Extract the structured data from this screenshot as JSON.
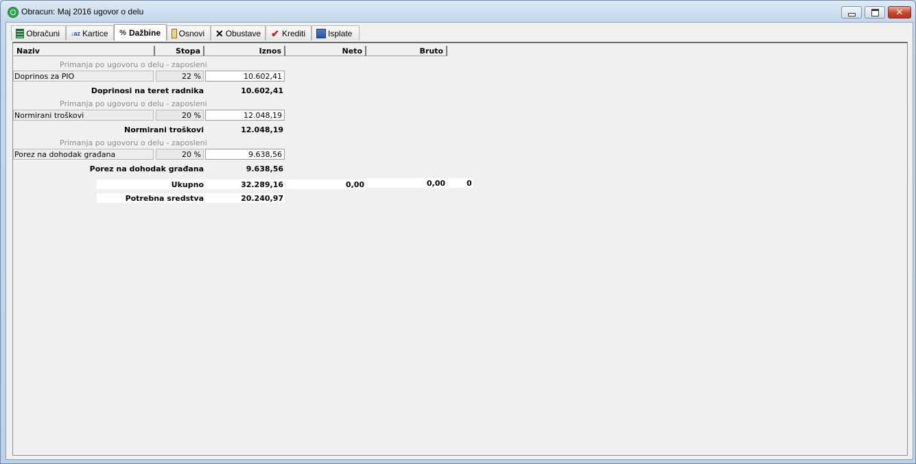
{
  "window": {
    "title": "Obracun: Maj 2016 ugovor o delu",
    "close_glyph": "✕"
  },
  "tabs": [
    {
      "label": "Obračuni",
      "icon": "calculator-grid-icon"
    },
    {
      "label": "Kartice",
      "icon": "sort-az-icon",
      "glyph": "↓az"
    },
    {
      "label": "Dažbine",
      "icon": "percent-icon",
      "glyph": "%"
    },
    {
      "label": "Osnovi",
      "icon": "document-icon"
    },
    {
      "label": "Obustave",
      "icon": "x-icon",
      "glyph": "✕"
    },
    {
      "label": "Krediti",
      "icon": "checkmark-icon",
      "glyph": "✔"
    },
    {
      "label": "Isplate",
      "icon": "stack-icon"
    }
  ],
  "active_tab": "Dažbine",
  "table": {
    "headers": {
      "naziv": "Naziv",
      "stopa": "Stopa",
      "iznos": "Iznos",
      "neto": "Neto",
      "bruto": "Bruto"
    },
    "groups": [
      {
        "section": "Primanja po ugovoru o delu - zaposleni",
        "naziv": "Doprinos za PIO",
        "stopa": "22 %",
        "iznos": "10.602,41",
        "subtotal_label": "Doprinosi na teret radnika",
        "subtotal_value": "10.602,41"
      },
      {
        "section": "Primanja po ugovoru o delu - zaposleni",
        "naziv": "Normirani troškovi",
        "stopa": "20 %",
        "iznos": "12.048,19",
        "subtotal_label": "Normirani troškovi",
        "subtotal_value": "12.048,19"
      },
      {
        "section": "Primanja po ugovoru o delu - zaposleni",
        "naziv": "Porez na dohodak građana",
        "stopa": "20 %",
        "iznos": "9.638,56",
        "subtotal_label": "Porez na dohodak građana",
        "subtotal_value": "9.638,56"
      }
    ],
    "ukupno": {
      "label": "Ukupno",
      "iznos": "32.289,16",
      "neto": "0,00",
      "bruto": "0,00",
      "extra": "0"
    },
    "potrebna": {
      "label": "Potrebna sredstva",
      "iznos": "20.240,97"
    }
  }
}
